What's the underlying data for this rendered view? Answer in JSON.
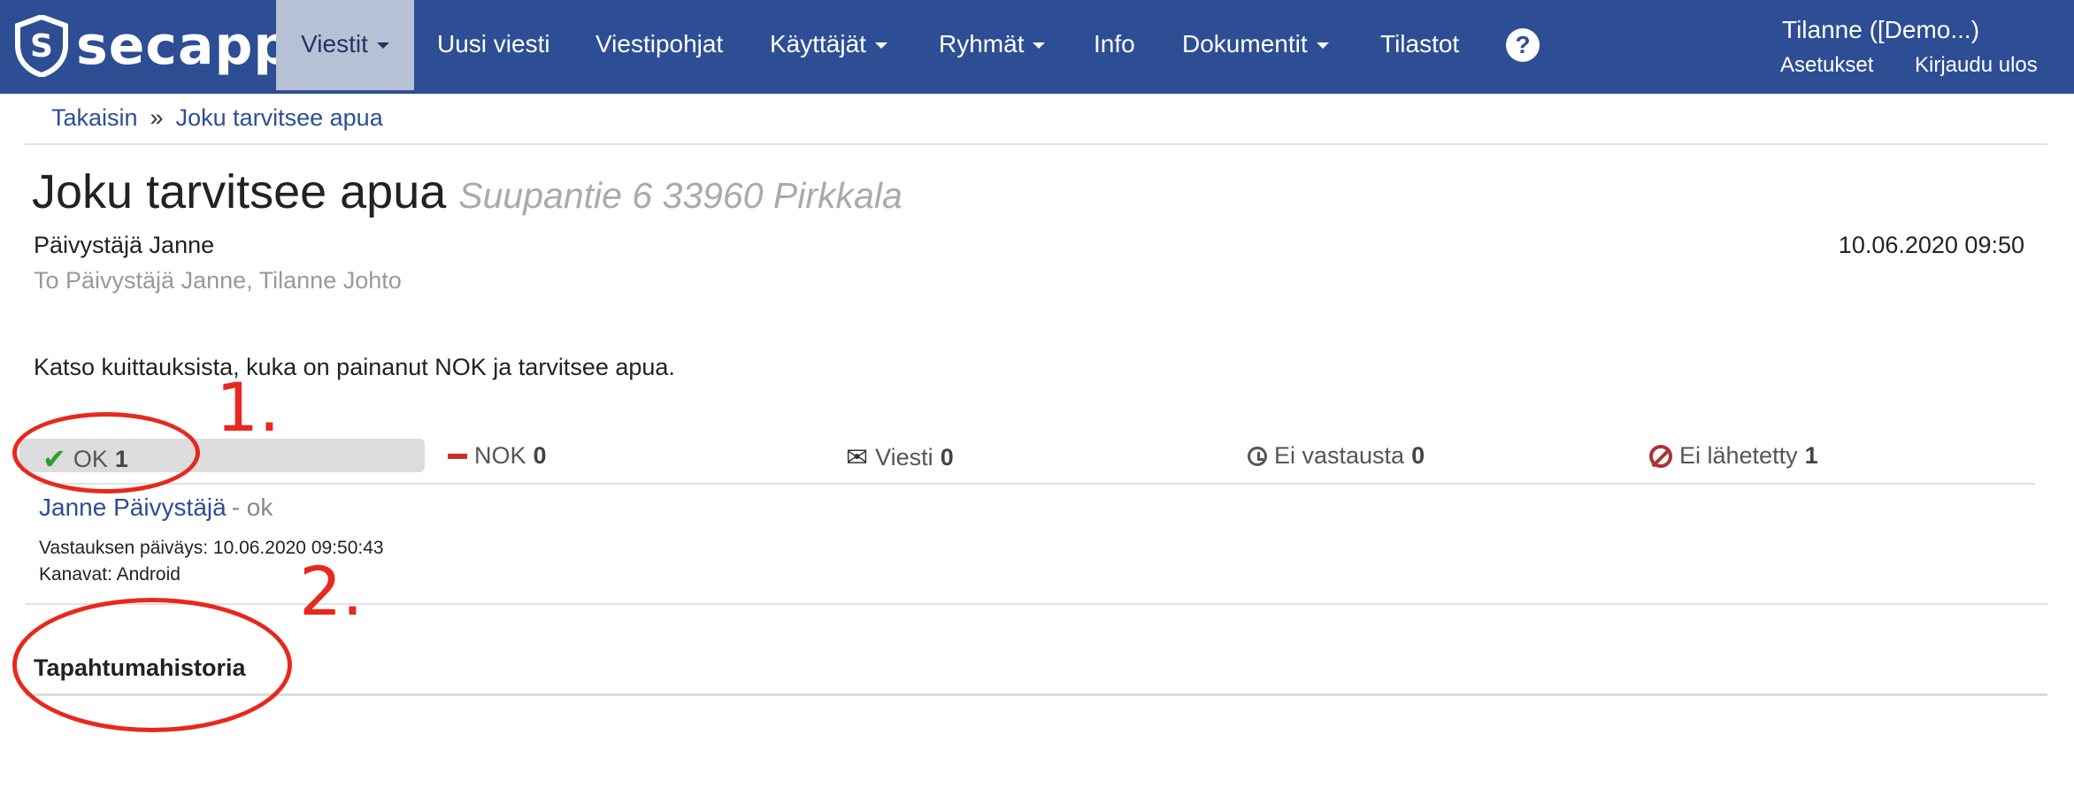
{
  "brand": {
    "name": "secapp",
    "logo_letter": "S",
    "color": "#2d4e94"
  },
  "nav": {
    "items": [
      {
        "label": "Viestit",
        "dropdown": true,
        "active": true
      },
      {
        "label": "Uusi viesti",
        "dropdown": false
      },
      {
        "label": "Viestipohjat",
        "dropdown": false
      },
      {
        "label": "Käyttäjät",
        "dropdown": true
      },
      {
        "label": "Ryhmät",
        "dropdown": true
      },
      {
        "label": "Info",
        "dropdown": false
      },
      {
        "label": "Dokumentit",
        "dropdown": true
      },
      {
        "label": "Tilastot",
        "dropdown": false
      }
    ],
    "help_label": "?",
    "user_title": "Tilanne  ([Demo...)",
    "settings_label": "Asetukset",
    "logout_label": "Kirjaudu ulos"
  },
  "breadcrumb": {
    "back": "Takaisin",
    "separator": "»",
    "current": "Joku tarvitsee apua"
  },
  "message": {
    "title": "Joku tarvitsee apua",
    "address": "Suupantie 6 33960 Pirkkala",
    "sender": "Päivystäjä Janne",
    "recipients": "To Päivystäjä Janne, Tilanne Johto",
    "datetime": "10.06.2020 09:50",
    "body": "Katso kuittauksista, kuka on painanut NOK ja tarvitsee apua."
  },
  "statuses": {
    "ok": {
      "label": "OK",
      "count": "1"
    },
    "nok": {
      "label": "NOK",
      "count": "0"
    },
    "message": {
      "label": "Viesti",
      "count": "0"
    },
    "no_answer": {
      "label": "Ei vastausta",
      "count": "0"
    },
    "not_sent": {
      "label": "Ei lähetetty",
      "count": "1"
    }
  },
  "response": {
    "name": "Janne Päivystäjä",
    "status": "- ok",
    "date_line": "Vastauksen päiväys: 10.06.2020 09:50:43",
    "channels_line": "Kanavat: Android"
  },
  "history": {
    "heading": "Tapahtumahistoria"
  },
  "annotations": {
    "one": "1.",
    "two": "2.",
    "color": "#e8281e"
  }
}
